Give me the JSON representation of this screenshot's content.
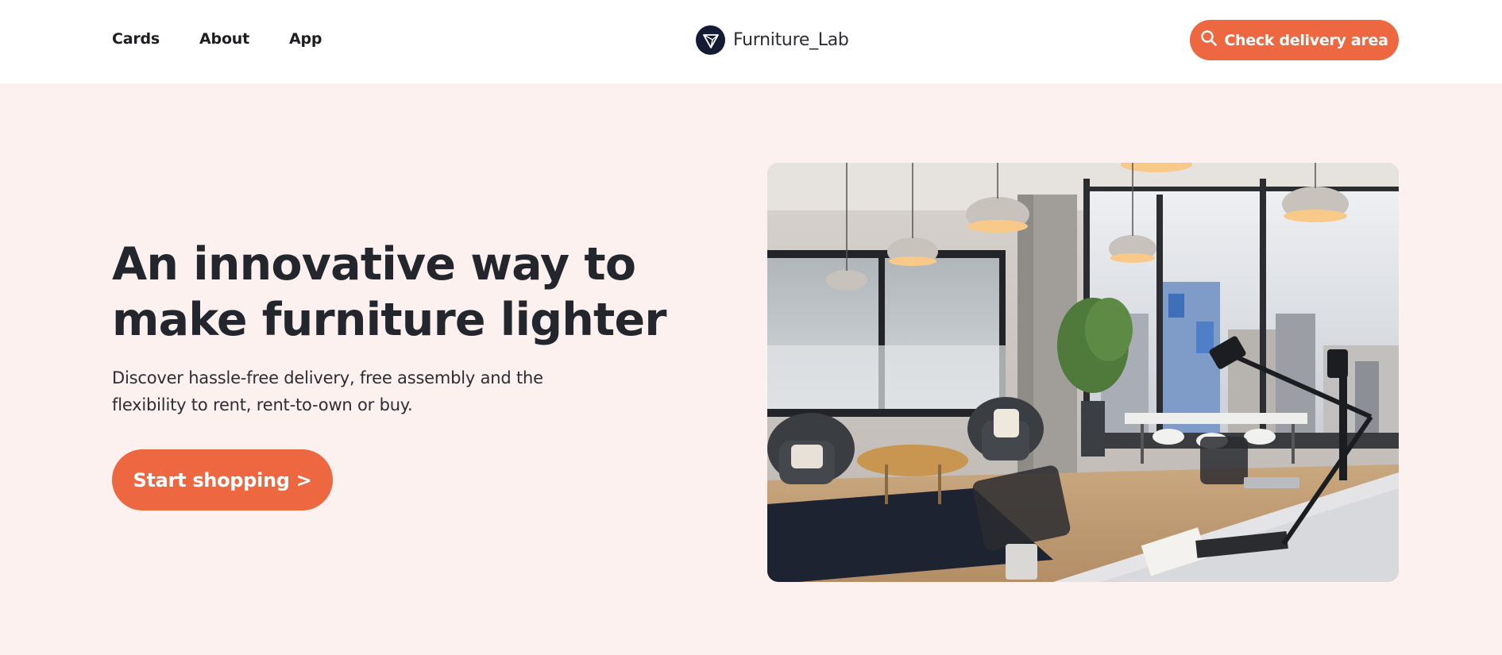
{
  "nav": {
    "links": [
      {
        "label": "Cards"
      },
      {
        "label": "About"
      },
      {
        "label": "App"
      }
    ],
    "brand": {
      "name": "Furniture_Lab",
      "icon": "triangle-logo-icon"
    },
    "cta": {
      "label": "Check delivery area",
      "icon": "search-icon"
    }
  },
  "hero": {
    "title_line1": "An innovative way to",
    "title_line2": "make furniture lighter",
    "subtitle_line1": "Discover hassle-free delivery, free assembly and the",
    "subtitle_line2": "flexibility to rent, rent-to-own or buy.",
    "cta_label": "Start shopping >",
    "image": "office-interior-photo"
  },
  "colors": {
    "accent": "#ed6840",
    "hero_bg": "#fdf1ef",
    "nav_bg": "#ffffff",
    "text": "#23262c",
    "logo_bg": "#151b33"
  }
}
